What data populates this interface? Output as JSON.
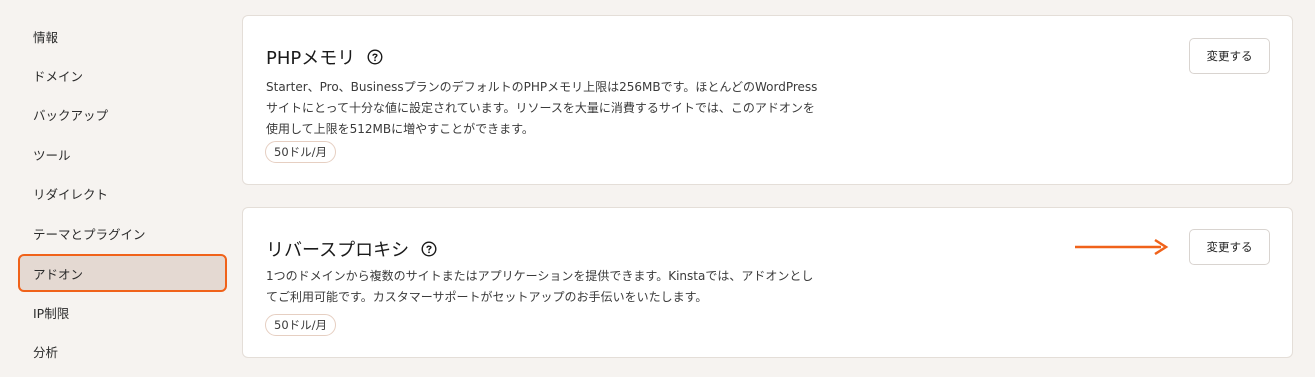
{
  "sidebar": {
    "items": [
      {
        "label": "情報"
      },
      {
        "label": "ドメイン"
      },
      {
        "label": "バックアップ"
      },
      {
        "label": "ツール"
      },
      {
        "label": "リダイレクト"
      },
      {
        "label": "テーマとプラグイン"
      },
      {
        "label": "アドオン",
        "active": true
      },
      {
        "label": "IP制限"
      },
      {
        "label": "分析"
      }
    ]
  },
  "cards": [
    {
      "title": "PHPメモリ",
      "help_icon": "question-circle-icon",
      "description_lines": [
        "Starter、Pro、BusinessプランのデフォルトのPHPメモリ上限は256MBです。ほとんどのWordPress",
        "サイトにとって十分な値に設定されています。リソースを大量に消費するサイトでは、このアドオンを",
        "使用して上限を512MBに増やすことができます。"
      ],
      "price": "50ドル/月",
      "button_label": "変更する"
    },
    {
      "title": "リバースプロキシ",
      "help_icon": "question-circle-icon",
      "description_lines": [
        "1つのドメインから複数のサイトまたはアプリケーションを提供できます。Kinstaでは、アドオンとし",
        "てご利用可能です。カスタマーサポートがセットアップのお手伝いをいたします。"
      ],
      "price": "50ドル/月",
      "button_label": "変更する"
    }
  ],
  "colors": {
    "highlight": "#f0621a",
    "background": "#f6f3f0",
    "active_bg": "#e4d9d2"
  },
  "annotation": {
    "icon": "arrow-right-icon"
  }
}
